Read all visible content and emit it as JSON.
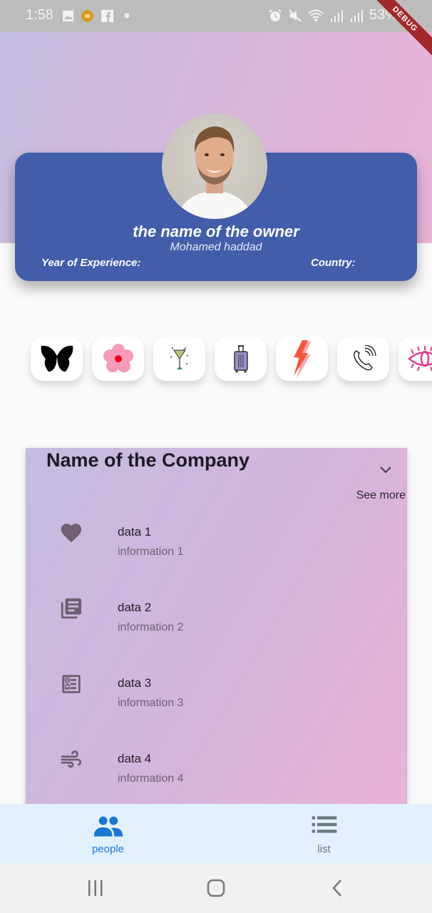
{
  "status_bar": {
    "time": "1:58",
    "battery": "53%",
    "left_icons": [
      "gallery-icon",
      "notification-app-icon",
      "facebook-icon",
      "dot-icon"
    ],
    "right_icons": [
      "alarm-icon",
      "mute-icon",
      "wifi-icon",
      "signal-icon",
      "signal-icon"
    ]
  },
  "debug_banner": "DEBUG",
  "profile": {
    "title": "the name of the owner",
    "name": "Mohamed haddad",
    "experience_label": "Year of Experience:",
    "country_label": "Country:",
    "card_color": "#425da9"
  },
  "icon_row": [
    {
      "name": "butterfly-icon"
    },
    {
      "name": "flower-icon"
    },
    {
      "name": "cocktail-icon"
    },
    {
      "name": "suitcase-icon"
    },
    {
      "name": "lightning-icon"
    },
    {
      "name": "phone-icon"
    },
    {
      "name": "eye-icon"
    }
  ],
  "company": {
    "title": "Name of the Company",
    "see_more": "See more",
    "items": [
      {
        "icon": "heart-icon",
        "title": "data 1",
        "subtitle": "information 1"
      },
      {
        "icon": "library-books-icon",
        "title": "data 2",
        "subtitle": "information 2"
      },
      {
        "icon": "list-alt-icon",
        "title": "data 3",
        "subtitle": "information 3"
      },
      {
        "icon": "wind-icon",
        "title": "data 4",
        "subtitle": "information 4"
      }
    ]
  },
  "bottom_nav": {
    "items": [
      {
        "label": "people",
        "icon": "people-icon",
        "active": true
      },
      {
        "label": "list",
        "icon": "list-icon",
        "active": false
      }
    ],
    "active_color": "#1976d2",
    "inactive_color": "#6b7680"
  }
}
